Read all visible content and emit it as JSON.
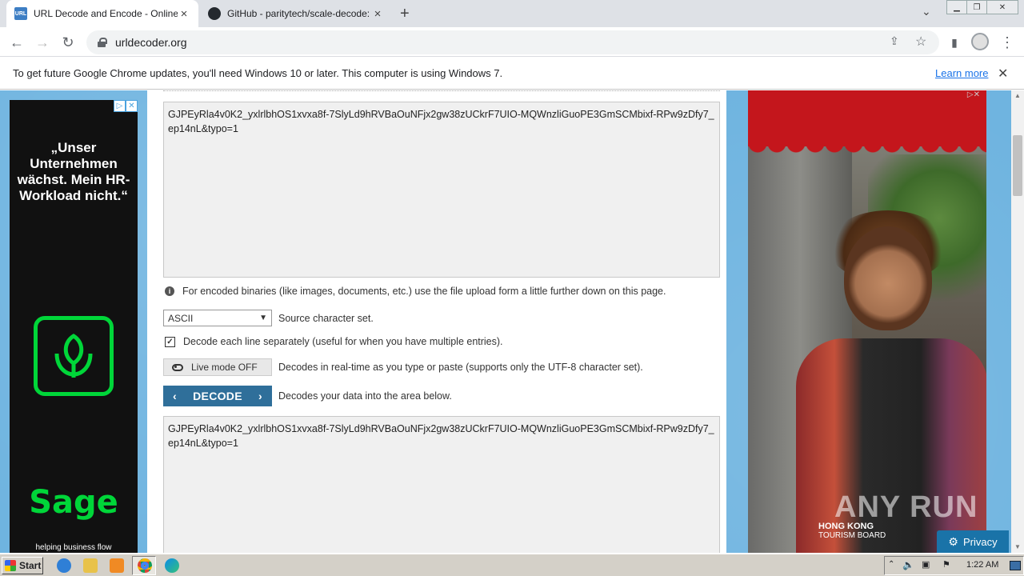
{
  "tabs": [
    {
      "title": "URL Decode and Encode - Online",
      "favicon": "URL"
    },
    {
      "title": "GitHub - paritytech/scale-decode: De",
      "favicon": "github-icon"
    }
  ],
  "address": {
    "url": "urldecoder.org"
  },
  "infobar": {
    "message": "To get future Google Chrome updates, you'll need Windows 10 or later. This computer is using Windows 7.",
    "link": "Learn more"
  },
  "decoder": {
    "input_text": "GJPEyRla4v0K2_yxlrlbhOS1xvxa8f-7SlyLd9hRVBaOuNFjx2gw38zUCkrF7UIO-MQWnzliGuoPE3GmSCMbixf-RPw9zDfy7_ep14nL&typo=1",
    "binary_note": "For encoded binaries (like images, documents, etc.) use the file upload form a little further down on this page.",
    "charset_value": "ASCII",
    "charset_label": "Source character set.",
    "each_line_label": "Decode each line separately (useful for when you have multiple entries).",
    "live_mode_label": "Live mode OFF",
    "live_mode_desc": "Decodes in real-time as you type or paste (supports only the UTF-8 character set).",
    "decode_label": "DECODE",
    "decode_desc": "Decodes your data into the area below.",
    "output_text": "GJPEyRla4v0K2_yxlrlbhOS1xvxa8f-7SlyLd9hRVBaOuNFjx2gw38zUCkrF7UIO-MQWnzliGuoPE3GmSCMbixf-RPw9zDfy7_ep14nL&typo=1"
  },
  "left_ad": {
    "quote": "„Unser Unternehmen wächst. Mein HR-Workload nicht.“",
    "brand": "Sage",
    "tagline": "helping business flow"
  },
  "right_ad": {
    "brand_line1": "HONG KONG",
    "brand_line2": "TOURISM BOARD",
    "watermark": "ANY RUN"
  },
  "privacy_label": "Privacy",
  "taskbar": {
    "start_label": "Start",
    "clock": "1:22 AM"
  }
}
